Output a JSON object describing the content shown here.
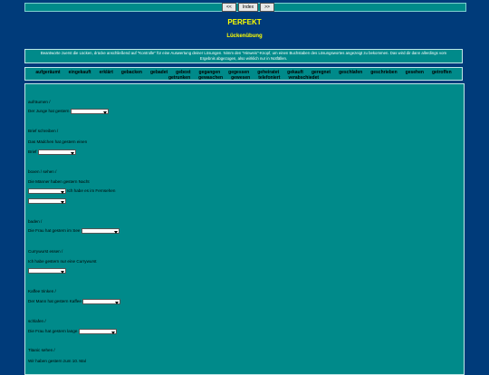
{
  "nav": {
    "prev": "<<",
    "index": "Index",
    "next": ">>"
  },
  "title": "PERFEKT",
  "subtitle": "Lückenübung",
  "instructions": "Beantworte zuerst die Lücken, drücke anschließend auf \"Kontrolle\" für eine Auswertung deiner Lösungen. Nimm den \"Hinweis\"-Knopf, um einen Buchstaben des Lösungswortes angezeigt zu bekommen. Das wird dir dann allerdings vom Ergebnis abgezogen, also wirklich nur in Notfällen.",
  "wordbank": [
    "aufgeräumt",
    "eingekauft",
    "erklärt",
    "gebacken",
    "gebadet",
    "geboxt",
    "gegangen",
    "gegessen",
    "geheiratet",
    "gekauft",
    "geregnet",
    "geschlafen",
    "geschrieben",
    "gesehen",
    "getroffen",
    "getrunken",
    "gewaschen",
    "gewesen",
    "telefoniert",
    "verabschiedet"
  ],
  "exercises": {
    "e1_cue": "aufräumen /",
    "e1_sentence": "Der Junge hat gestern",
    "e2_cue": "Brief schreiben /",
    "e2_sentence": "Das Mädchen hat gestern einen",
    "e2_word": "Brief",
    "e3_cue": "boxen / sehen /",
    "e3_sentence": "Die Männer haben gestern Nacht",
    "e3_tail": "Ich habe es im Fernsehen",
    "e4_cue": "baden /",
    "e4_sentence": "Die Frau hat gestern im See",
    "e5_cue": "Currywurst essen /",
    "e5_sentence": "Ich habe gestern nur eine Currywurst",
    "e6_cue": "Kaffee trinken /",
    "e6_sentence": "Der Mann hat gestern Kaffee",
    "e7_cue": "schlafen /",
    "e7_sentence": "Die Frau hat gestern lange",
    "e8_cue": "Titanic sehen /",
    "e8_sentence": "Wir haben gestern zum 10. Mal"
  }
}
